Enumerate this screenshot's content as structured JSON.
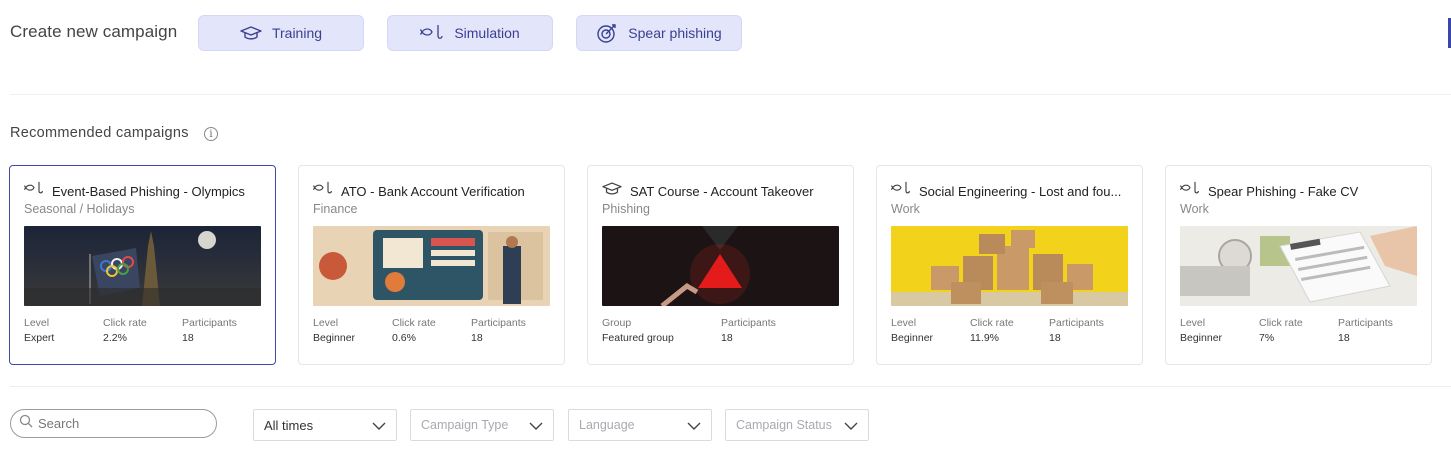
{
  "header": {
    "title": "Create new campaign",
    "buttons": [
      {
        "label": "Training",
        "icon": "graduation-cap-icon"
      },
      {
        "label": "Simulation",
        "icon": "fish-hook-icon"
      },
      {
        "label": "Spear phishing",
        "icon": "target-icon"
      }
    ]
  },
  "recommended": {
    "title": "Recommended campaigns",
    "info_icon": "i",
    "cards": [
      {
        "title": "Event-Based Phishing - Olympics",
        "category": "Seasonal / Holidays",
        "icon": "fish-hook-icon",
        "image": "paris-2024-olympics-image",
        "stats": [
          {
            "label": "Level",
            "value": "Expert"
          },
          {
            "label": "Click rate",
            "value": "2.2%"
          },
          {
            "label": "Participants",
            "value": "18"
          }
        ]
      },
      {
        "title": "ATO - Bank Account Verification",
        "category": "Finance",
        "icon": "fish-hook-icon",
        "image": "bank-verification-image",
        "stats": [
          {
            "label": "Level",
            "value": "Beginner"
          },
          {
            "label": "Click rate",
            "value": "0.6%"
          },
          {
            "label": "Participants",
            "value": "18"
          }
        ]
      },
      {
        "title": "SAT Course - Account Takeover",
        "category": "Phishing",
        "icon": "graduation-cap-icon",
        "image": "account-takeover-warning-image",
        "stats": [
          {
            "label": "Group",
            "value": "Featured group"
          },
          {
            "label": "Participants",
            "value": "18"
          }
        ]
      },
      {
        "title": "Social Engineering - Lost and fou...",
        "category": "Work",
        "icon": "fish-hook-icon",
        "image": "cardboard-boxes-image",
        "stats": [
          {
            "label": "Level",
            "value": "Beginner"
          },
          {
            "label": "Click rate",
            "value": "11.9%"
          },
          {
            "label": "Participants",
            "value": "18"
          }
        ]
      },
      {
        "title": "Spear Phishing - Fake CV",
        "category": "Work",
        "icon": "fish-hook-icon",
        "image": "resume-document-image",
        "stats": [
          {
            "label": "Level",
            "value": "Beginner"
          },
          {
            "label": "Click rate",
            "value": "7%"
          },
          {
            "label": "Participants",
            "value": "18"
          }
        ]
      }
    ]
  },
  "filters": {
    "search_placeholder": "Search",
    "time": "All times",
    "campaign_type": "Campaign Type",
    "language": "Language",
    "campaign_status": "Campaign Status"
  },
  "colors": {
    "accent": "#3f4aa8",
    "button_bg": "#e3e6fb",
    "button_text": "#3a3f8f"
  }
}
